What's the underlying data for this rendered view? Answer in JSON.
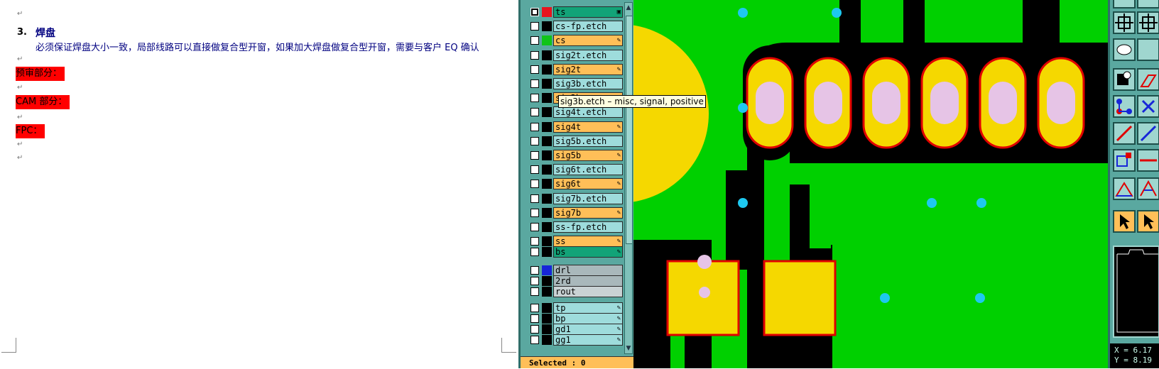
{
  "document": {
    "heading_number": "3.",
    "heading_text": "焊盘",
    "body_text": "必须保证焊盘大小一致，局部线路可以直接做复合型开窗，如果加大焊盘做复合型开窗，需要与客户 EQ 确认",
    "red_labels": [
      "预审部分：",
      "CAM 部分：",
      "FPC："
    ],
    "paragraph_mark": "↵"
  },
  "layer_panel": {
    "layers": [
      {
        "name": "ts",
        "color": "teal",
        "swatch": "#e8141e",
        "pen": "▣",
        "checked": true
      },
      {
        "name": "cs-fp.etch",
        "color": "cyan",
        "swatch": "#000000",
        "pen": "",
        "checked": false
      },
      {
        "name": "cs",
        "color": "orange",
        "swatch": "#10c418",
        "pen": "✎",
        "checked": false
      },
      {
        "name": "sig2t.etch",
        "color": "cyan",
        "swatch": "#000000",
        "pen": "",
        "checked": false
      },
      {
        "name": "sig2t",
        "color": "orange",
        "swatch": "#000000",
        "pen": "✎",
        "checked": false
      },
      {
        "name": "sig3b.etch",
        "color": "cyan",
        "swatch": "#000000",
        "pen": "",
        "checked": false
      },
      {
        "name": "sig3b",
        "color": "orange",
        "swatch": "#000000",
        "pen": "✎",
        "checked": false
      },
      {
        "name": "sig4t.etch",
        "color": "cyan",
        "swatch": "#000000",
        "pen": "",
        "checked": false
      },
      {
        "name": "sig4t",
        "color": "orange",
        "swatch": "#000000",
        "pen": "✎",
        "checked": false
      },
      {
        "name": "sig5b.etch",
        "color": "cyan",
        "swatch": "#000000",
        "pen": "",
        "checked": false
      },
      {
        "name": "sig5b",
        "color": "orange",
        "swatch": "#000000",
        "pen": "✎",
        "checked": false
      },
      {
        "name": "sig6t.etch",
        "color": "cyan",
        "swatch": "#000000",
        "pen": "",
        "checked": false
      },
      {
        "name": "sig6t",
        "color": "orange",
        "swatch": "#000000",
        "pen": "✎",
        "checked": false
      },
      {
        "name": "sig7b.etch",
        "color": "cyan",
        "swatch": "#000000",
        "pen": "",
        "checked": false
      },
      {
        "name": "sig7b",
        "color": "orange",
        "swatch": "#000000",
        "pen": "✎",
        "checked": false
      },
      {
        "name": "ss-fp.etch",
        "color": "cyan",
        "swatch": "#000000",
        "pen": "",
        "checked": false
      },
      {
        "name": "ss",
        "color": "orange",
        "swatch": "#000000",
        "pen": "✎",
        "checked": false
      },
      {
        "name": "bs",
        "color": "teal",
        "swatch": "#000000",
        "pen": "✎",
        "checked": false
      },
      {
        "name": "drl",
        "color": "grey",
        "swatch": "#1726d8",
        "pen": "",
        "checked": false
      },
      {
        "name": "2rd",
        "color": "grey",
        "swatch": "#000000",
        "pen": "",
        "checked": false
      },
      {
        "name": "rout",
        "color": "ltgrey",
        "swatch": "#000000",
        "pen": "",
        "checked": false
      },
      {
        "name": "tp",
        "color": "cyan",
        "swatch": "#000000",
        "pen": "✎",
        "checked": false
      },
      {
        "name": "bp",
        "color": "cyan",
        "swatch": "#000000",
        "pen": "✎",
        "checked": false
      },
      {
        "name": "gd1",
        "color": "cyan",
        "swatch": "#000000",
        "pen": "✎",
        "checked": false
      },
      {
        "name": "gg1",
        "color": "cyan",
        "swatch": "#000000",
        "pen": "✎",
        "checked": false
      }
    ],
    "tooltip": "sig3b.etch – misc, signal, positive",
    "selected_label": "Selected : 0"
  },
  "colors": {
    "board_green": "#00d000",
    "pad_yellow": "#f5d800",
    "pad_outline_red": "#e00000",
    "etch_black": "#000000",
    "hole_pink": "#e6c4e6",
    "via_cyan": "#1ec8f0"
  },
  "toolbar": {
    "icons": [
      "zoom-fit-icon",
      "pan-icon",
      "zoom-icon",
      "pan-alt-icon",
      "palette-icon",
      "select-shape-icon",
      "shape-outline-icon",
      "connect-nodes-icon",
      "cross-nodes-icon",
      "line-draw-icon",
      "line-slope-icon",
      "add-node-icon",
      "line-horizontal-icon",
      "triangle-angle-icon",
      "triangle-measure-icon",
      "arrow-select-icon",
      "arrow-select-alt-icon"
    ]
  },
  "coordinates": {
    "x_label": "X = 6.17",
    "y_label": "Y = 8.19"
  }
}
